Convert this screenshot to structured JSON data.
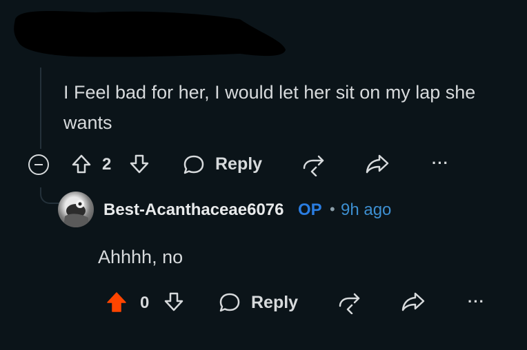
{
  "parent_comment": {
    "body": "I Feel bad for her, I would let her sit on my lap she wants",
    "upvotes": "2",
    "reply_label": "Reply",
    "more_label": "···"
  },
  "reply_comment": {
    "username": "Best-Acanthaceae6076",
    "op_tag": "OP",
    "separator": "•",
    "time": "9h ago",
    "body": "Ahhhh, no",
    "upvotes": "0",
    "reply_label": "Reply",
    "more_label": "···",
    "upvoted": true
  },
  "colors": {
    "background": "#0b1419",
    "text": "#d7dadc",
    "op": "#2a7de1",
    "time": "#3d8fd1",
    "upvote_active": "#ff4500"
  }
}
